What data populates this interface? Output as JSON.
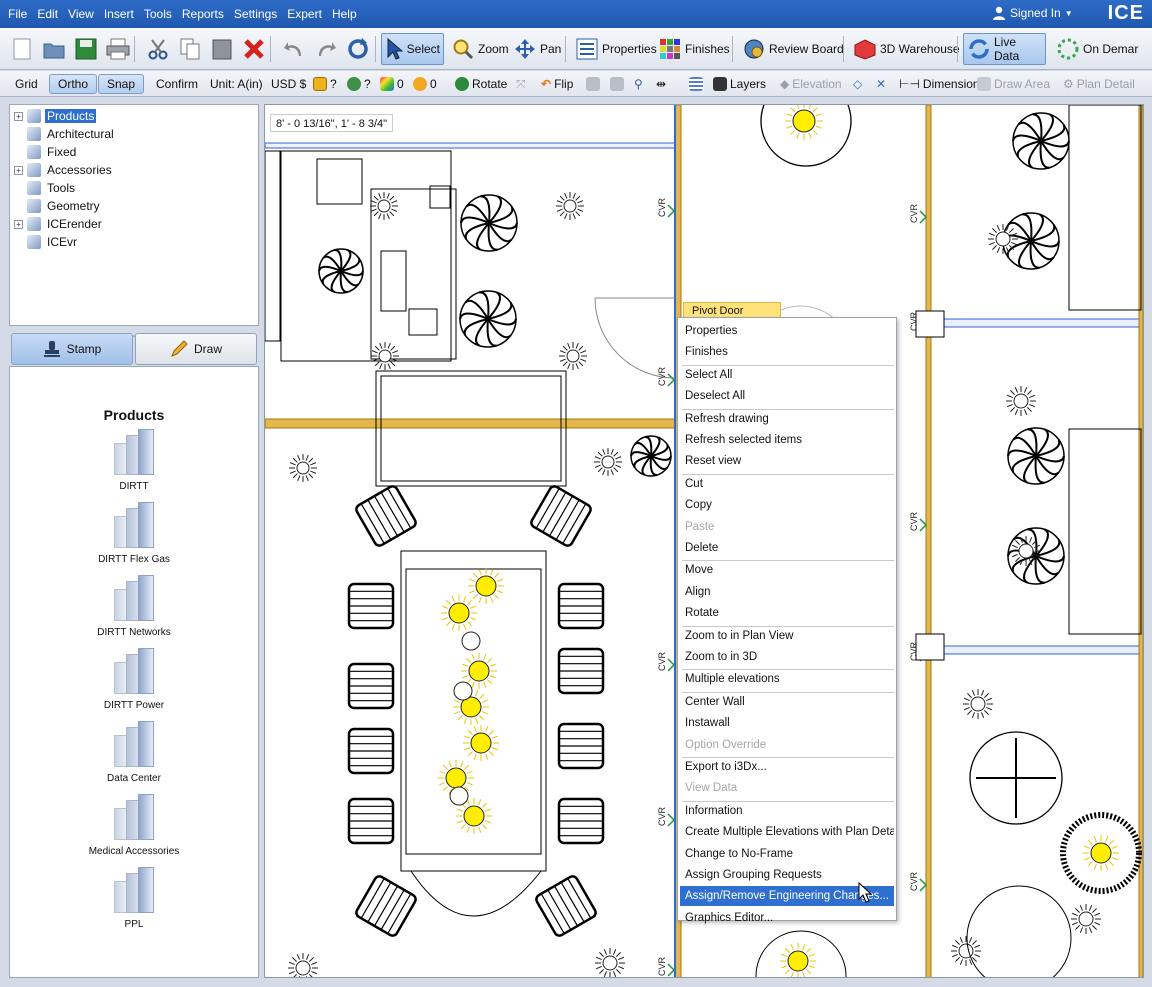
{
  "menubar": {
    "items": [
      "File",
      "Edit",
      "View",
      "Insert",
      "Tools",
      "Reports",
      "Settings",
      "Expert",
      "Help"
    ],
    "signin": "Signed In",
    "brand": "ICE"
  },
  "toolbar1": {
    "select": "Select",
    "zoom": "Zoom",
    "pan": "Pan",
    "properties": "Properties",
    "finishes": "Finishes",
    "review_board": "Review Board",
    "warehouse": "3D Warehouse",
    "live_data": "Live Data",
    "on_demand": "On Demar"
  },
  "toolbar2": {
    "grid": "Grid",
    "ortho": "Ortho",
    "snap": "Snap",
    "confirm": "Confirm",
    "unit": "Unit: A(in)",
    "currency": "USD $",
    "q1": "?",
    "q2": "?",
    "count1": "0",
    "count2": "0",
    "rotate": "Rotate",
    "flip": "Flip",
    "layers": "Layers",
    "elevation": "Elevation",
    "dimension": "Dimension",
    "draw_area": "Draw Area",
    "plan_detail": "Plan Detail"
  },
  "tree": {
    "items": [
      {
        "label": "Products",
        "expandable": true,
        "selected": true
      },
      {
        "label": "Architectural",
        "expandable": false
      },
      {
        "label": "Fixed",
        "expandable": false
      },
      {
        "label": "Accessories",
        "expandable": true
      },
      {
        "label": "Tools",
        "expandable": false
      },
      {
        "label": "Geometry",
        "expandable": false
      },
      {
        "label": "ICErender",
        "expandable": true
      },
      {
        "label": "ICEvr",
        "expandable": false
      }
    ]
  },
  "tabs": {
    "stamp": "Stamp",
    "draw": "Draw"
  },
  "catalog": {
    "title": "Products",
    "items": [
      "DIRTT",
      "DIRTT Flex Gas",
      "DIRTT Networks",
      "DIRTT Power",
      "Data Center",
      "Medical Accessories",
      "PPL"
    ]
  },
  "canvas": {
    "coordinates": "8' - 0 13/16\", 1' - 8 3/4\"",
    "cvr_label": "CVR"
  },
  "context_menu": {
    "target_label": "Pivot Door",
    "items": [
      {
        "label": "Properties"
      },
      {
        "label": "Finishes"
      },
      {
        "sep": true
      },
      {
        "label": "Select All"
      },
      {
        "label": "Deselect All"
      },
      {
        "sep": true
      },
      {
        "label": "Refresh drawing"
      },
      {
        "label": "Refresh selected items"
      },
      {
        "label": "Reset view"
      },
      {
        "sep": true
      },
      {
        "label": "Cut"
      },
      {
        "label": "Copy"
      },
      {
        "label": "Paste",
        "disabled": true
      },
      {
        "label": "Delete"
      },
      {
        "sep": true
      },
      {
        "label": "Move"
      },
      {
        "label": "Align"
      },
      {
        "label": "Rotate"
      },
      {
        "sep": true
      },
      {
        "label": "Zoom to in Plan View"
      },
      {
        "label": "Zoom to in 3D"
      },
      {
        "sep": true
      },
      {
        "label": "Multiple elevations"
      },
      {
        "sep": true
      },
      {
        "label": "Center Wall"
      },
      {
        "label": "Instawall"
      },
      {
        "label": "Option Override",
        "disabled": true
      },
      {
        "sep": true
      },
      {
        "label": "Export to i3Dx..."
      },
      {
        "label": "View Data",
        "disabled": true
      },
      {
        "sep": true
      },
      {
        "label": "Information"
      },
      {
        "label": "Create Multiple Elevations with Plan Details"
      },
      {
        "label": "Change to No-Frame"
      },
      {
        "label": "Assign Grouping Requests"
      },
      {
        "label": "Assign/Remove Engineering Changes...",
        "highlight": true
      },
      {
        "label": "Graphics Editor..."
      }
    ]
  },
  "colors": {
    "menubar": "#2563c0",
    "selection": "#2f6fd0",
    "wall": "#e5b64a",
    "light": "#ffee00"
  }
}
